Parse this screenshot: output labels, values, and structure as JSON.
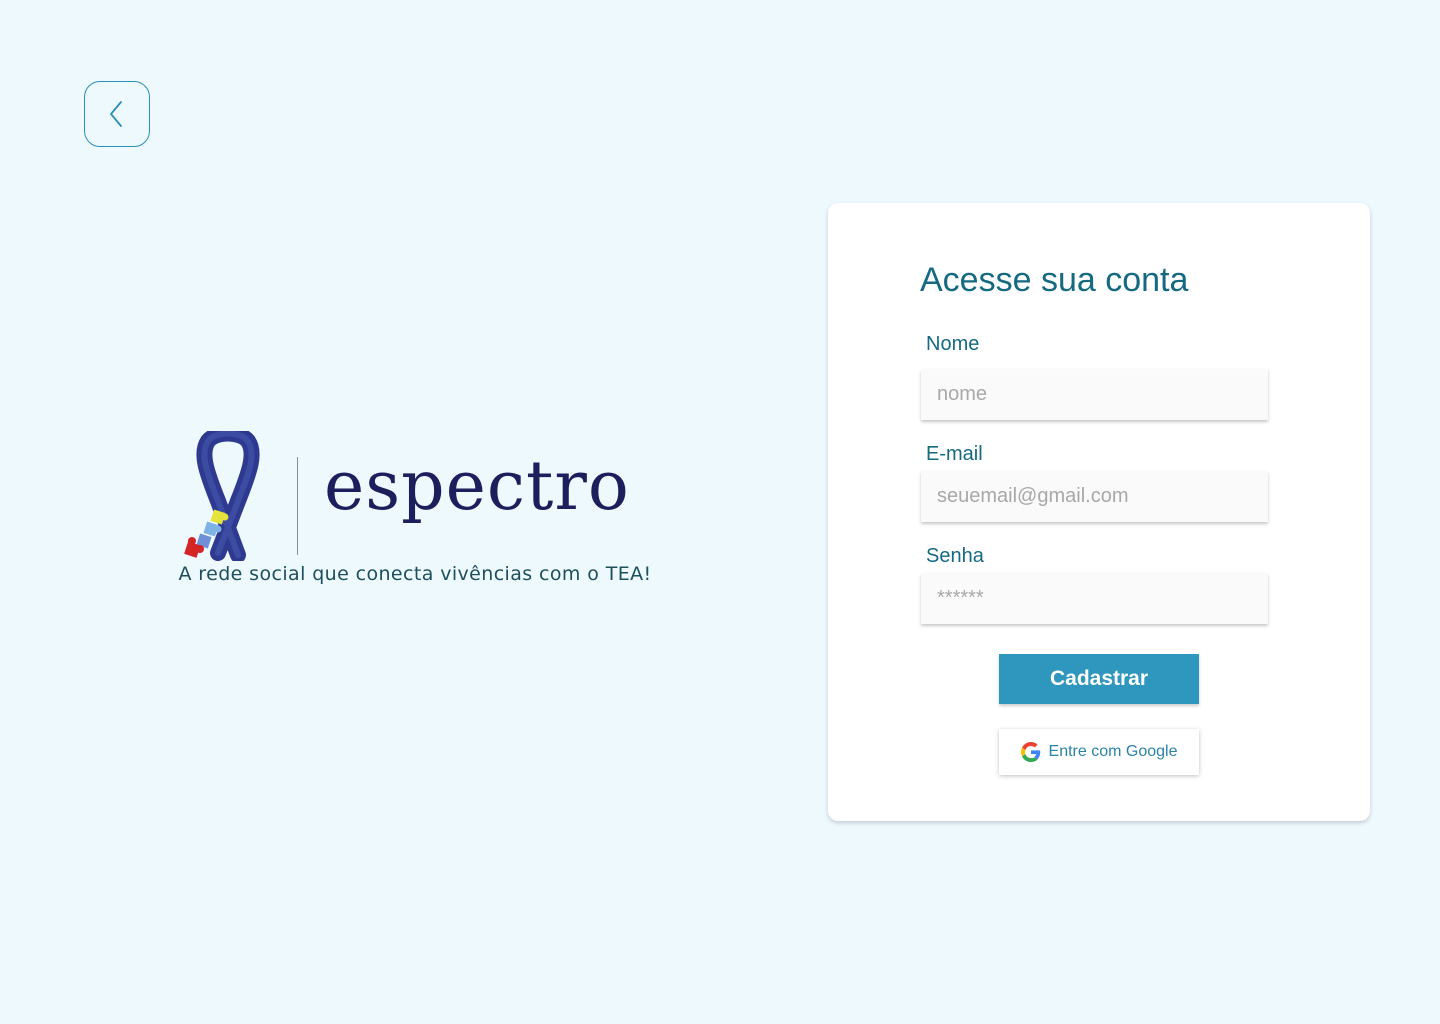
{
  "header": {
    "back_icon": "chevron-left-icon"
  },
  "brand": {
    "name": "espectro",
    "tagline": "A rede social que conecta vivências com o TEA!",
    "logo_icon": "awareness-ribbon-puzzle-icon"
  },
  "form": {
    "title": "Acesse sua conta",
    "fields": [
      {
        "label": "Nome",
        "placeholder": "nome",
        "value": ""
      },
      {
        "label": "E-mail",
        "placeholder": "seuemail@gmail.com",
        "value": ""
      },
      {
        "label": "Senha",
        "placeholder": "******",
        "value": ""
      }
    ],
    "submit_label": "Cadastrar",
    "google_label": "Entre com Google",
    "google_icon": "google-icon"
  },
  "colors": {
    "background": "#eef9fe",
    "accent": "#2f96be",
    "title_text": "#156a82",
    "brand_text": "#1c1f5c",
    "ribbon": "#2e3a8f"
  }
}
